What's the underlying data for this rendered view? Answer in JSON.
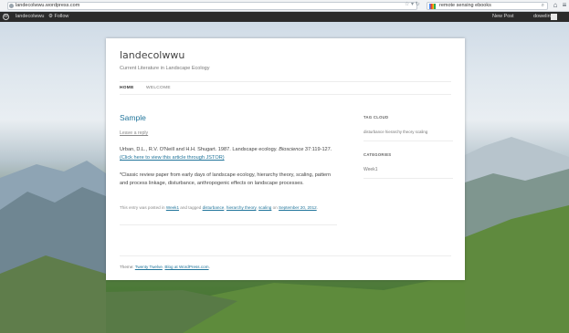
{
  "browser": {
    "url": "landecolwwu.wordpress.com",
    "search_query": "remote sensing ebooks"
  },
  "adminbar": {
    "site_name": "landecolwwu",
    "follow_label": "Follow",
    "new_post_label": "New Post",
    "user_name": "dowelin"
  },
  "site": {
    "title": "landecolwwu",
    "description": "Current Literature in Landscape Ecology"
  },
  "nav": {
    "home": "HOME",
    "welcome": "WELCOME"
  },
  "post": {
    "title": "Sample",
    "reply_link": "Leave a reply",
    "citation_prefix": "Urban, D.L., R.V. O'Neill and H.H. Shugart. 1987. Landscape ecology. ",
    "citation_journal": "Bioscience",
    "citation_suffix": " 37:119-127.",
    "jstor_link": "(Click here to view this article through JSTOR)",
    "summary": "*Classic review paper from early days of landscape ecology, hierarchy theory, scaling, pattern and process linkage, disturbance, anthropogenic effects on landscape processes.",
    "meta_prefix": "This entry was posted in ",
    "meta_category": "Week1",
    "meta_tagged": " and tagged ",
    "meta_tag1": "disturbance",
    "meta_tag2": "hierarchy theory",
    "meta_tag3": "scaling",
    "meta_on": " on ",
    "meta_date": "September 20, 2012"
  },
  "sidebar": {
    "tag_cloud_title": "TAG CLOUD",
    "tags": "disturbance  hierarchy theory  scaling",
    "categories_title": "CATEGORIES",
    "category_item": "Week1"
  },
  "footer": {
    "prefix": "Theme: ",
    "theme_link": "Twenty Twelve",
    "separator": ". ",
    "blog_link": "Blog at WordPress.com",
    "suffix": "."
  }
}
